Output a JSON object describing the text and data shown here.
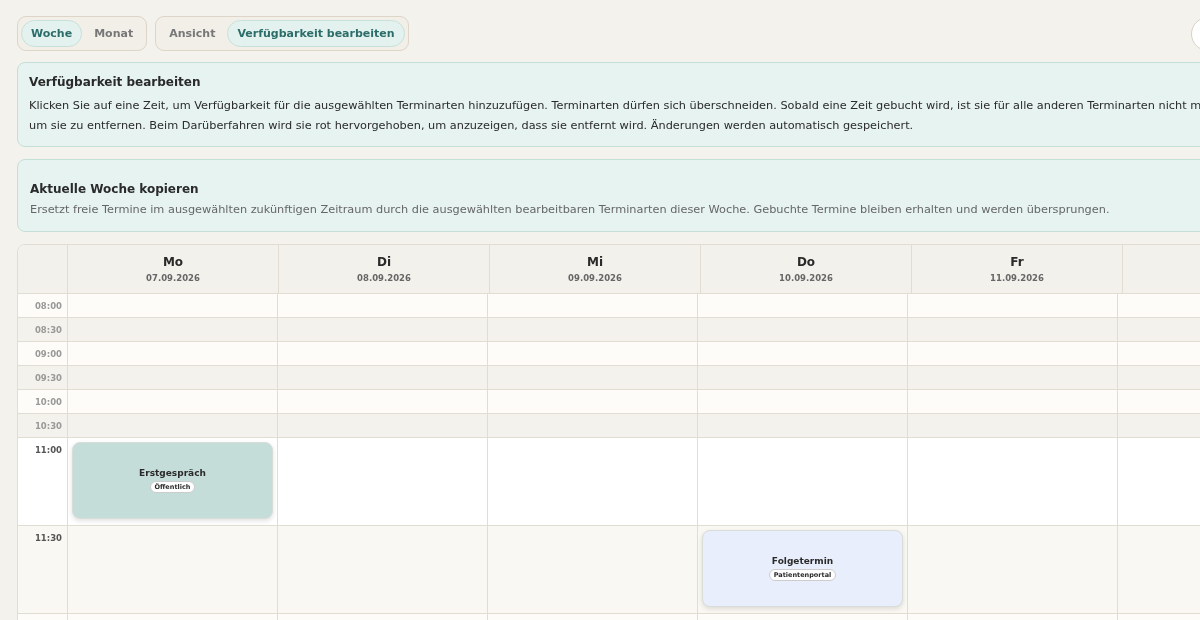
{
  "toolbar": {
    "range_tabs": [
      {
        "label": "Woche",
        "selected": true
      },
      {
        "label": "Monat",
        "selected": false
      }
    ],
    "mode_tabs": [
      {
        "label": "Ansicht",
        "selected": false
      },
      {
        "label": "Verfügbarkeit bearbeiten",
        "selected": true
      }
    ]
  },
  "edit_panel": {
    "title": "Verfügbarkeit bearbeiten",
    "lines": [
      "Klicken Sie auf eine Zeit, um Verfügbarkeit für die ausgewählten Terminarten hinzuzufügen. Terminarten dürfen sich überschneiden. Sobald eine Zeit gebucht wird, ist sie für alle anderen Terminarten nicht m",
      "um sie zu entfernen. Beim Darüberfahren wird sie rot hervorgehoben, um anzuzeigen, dass sie entfernt wird. Änderungen werden automatisch gespeichert."
    ]
  },
  "copy_panel": {
    "title": "Aktuelle Woche kopieren",
    "text": "Ersetzt freie Termine im ausgewählten zukünftigen Zeitraum durch die ausgewählten bearbeitbaren Terminarten dieser Woche. Gebuchte Termine bleiben erhalten und werden übersprungen."
  },
  "calendar": {
    "days": [
      {
        "name": "Mo",
        "date": "07.09.2026"
      },
      {
        "name": "Di",
        "date": "08.09.2026"
      },
      {
        "name": "Mi",
        "date": "09.09.2026"
      },
      {
        "name": "Do",
        "date": "10.09.2026"
      },
      {
        "name": "Fr",
        "date": "11.09.2026"
      }
    ],
    "rows": [
      {
        "time": "08:00",
        "kind": "short",
        "cells": [
          null,
          null,
          null,
          null,
          null,
          null
        ]
      },
      {
        "time": "08:30",
        "kind": "short",
        "cells": [
          null,
          null,
          null,
          null,
          null,
          null
        ]
      },
      {
        "time": "09:00",
        "kind": "short",
        "cells": [
          null,
          null,
          null,
          null,
          null,
          null
        ]
      },
      {
        "time": "09:30",
        "kind": "short",
        "cells": [
          null,
          null,
          null,
          null,
          null,
          null
        ]
      },
      {
        "time": "10:00",
        "kind": "short",
        "cells": [
          null,
          null,
          null,
          null,
          null,
          null
        ]
      },
      {
        "time": "10:30",
        "kind": "short",
        "cells": [
          null,
          null,
          null,
          null,
          null,
          null
        ]
      },
      {
        "time": "11:00",
        "kind": "tall",
        "cells": [
          {
            "title": "Erstgespräch",
            "tag": "Öffentlich",
            "color": "#c5ddd9"
          },
          null,
          null,
          null,
          null,
          null
        ]
      },
      {
        "time": "11:30",
        "kind": "tall",
        "cells": [
          null,
          null,
          null,
          {
            "title": "Folgetermin",
            "tag": "Patientenportal",
            "color": "#e8eefb"
          },
          null,
          null
        ]
      }
    ]
  }
}
